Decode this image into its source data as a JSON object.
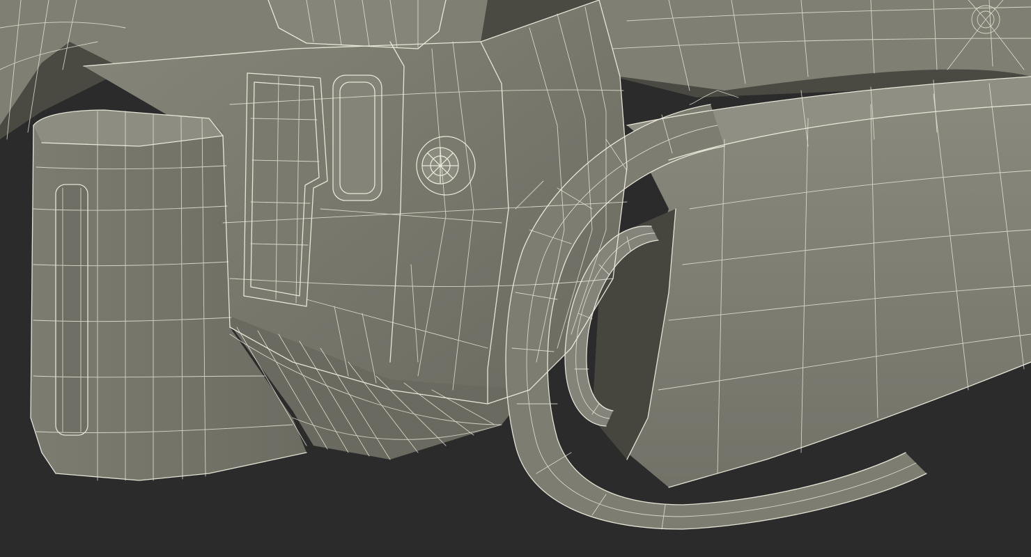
{
  "scene": {
    "description_kind": "wireframe-render",
    "colors": {
      "background": "#2b2b2b",
      "surface": "#77776c",
      "surface_light": "#8c8c80",
      "surface_dark": "#54544b",
      "shadow": "#3a3a34",
      "wire": "#f2f0e2"
    },
    "objects": [
      "battery-pack",
      "motor-housing",
      "vent-grille-panel",
      "button",
      "round-plug",
      "front-handle",
      "chain-bar",
      "bar-mount-ring"
    ]
  }
}
